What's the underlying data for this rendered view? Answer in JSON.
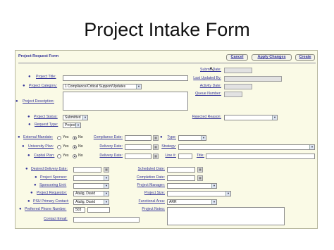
{
  "slide_title": "Project Intake Form",
  "form": {
    "title": "Project Request Form",
    "buttons": {
      "cancel": "Cancel",
      "apply": "Apply Changes",
      "create": "Create"
    },
    "labels": {
      "project_title": "Project Title:",
      "project_category": "Project Category:",
      "project_description": "Project Description:",
      "project_status": "Project Status:",
      "request_type": "Request Type:",
      "external_mandate": "External Mandate:",
      "university_plan": "University Plan:",
      "capital_plan": "Capital Plan:",
      "desired_delivery_date": "Desired Delivery Date:",
      "project_sponsor": "Project Sponsor:",
      "sponsoring_unit": "Sponsoring Unit:",
      "project_requestor": "Project Requestor:",
      "psu_primary_contact": "PSU Primary Contact:",
      "preferred_phone": "Preferred Phone Number:",
      "contact_email": "Contact Email:",
      "submit_date": "Submit Date:",
      "last_updated_by": "Last Updated By:",
      "activity_date": "Activity Date:",
      "queue_number": "Queue Number:",
      "rejected_reason": "Rejected Reason:",
      "compliance_date": "Compliance Date:",
      "delivery_date": "Delivery Date:",
      "type": "Type:",
      "strategy": "Strategy:",
      "line": "Line #:",
      "title": "Title:",
      "scheduled_date": "Scheduled Date:",
      "completion_date": "Completion Date:",
      "project_manager": "Project Manager:",
      "project_size": "Project Size:",
      "functional_area": "Functional Area:",
      "project_notes": "Project Notes:"
    },
    "values": {
      "project_category": "1 Compliance/Critical Support/Updates",
      "project_status": "Submitted",
      "request_type": "Project",
      "project_requestor": "Atalig, David",
      "psu_primary_contact": "Atalig, David",
      "preferred_phone": "503",
      "functional_area": "ARR"
    },
    "radio": {
      "yes": "Yes",
      "no": "No"
    }
  }
}
